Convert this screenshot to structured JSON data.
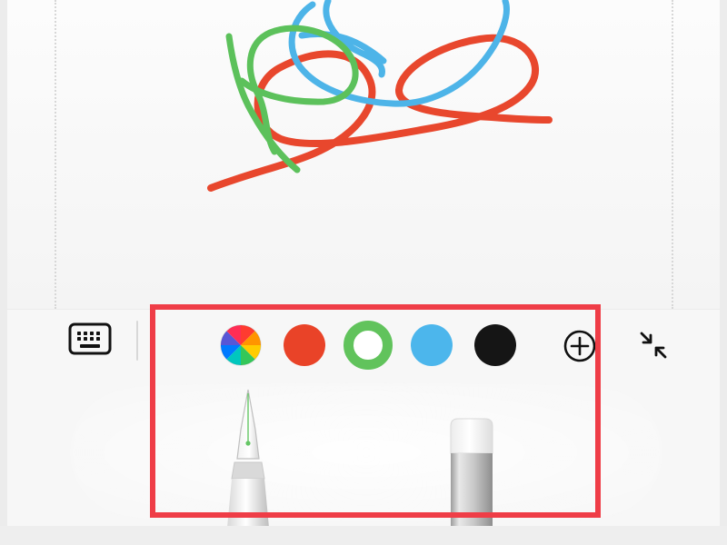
{
  "canvas": {
    "strokes": [
      {
        "color_name": "red",
        "color": "#e8472d"
      },
      {
        "color_name": "blue",
        "color": "#4db4e8"
      },
      {
        "color_name": "green",
        "color": "#5cc15b"
      }
    ]
  },
  "toolbar": {
    "keyboard_icon": "keyboard-icon",
    "divider": "vertical-divider",
    "swatches": [
      {
        "name": "rainbow",
        "color": "multicolor-wheel"
      },
      {
        "name": "red",
        "color": "#e94328"
      },
      {
        "name": "green",
        "color": "#61c35c",
        "selected": true
      },
      {
        "name": "blue",
        "color": "#4cb6ec"
      },
      {
        "name": "black",
        "color": "#151515"
      }
    ],
    "add_icon": "plus-circle-icon",
    "minimize_icon": "collapse-arrows-icon"
  },
  "tools": [
    {
      "name": "pen",
      "icon": "pen-icon"
    },
    {
      "name": "eraser",
      "icon": "eraser-icon"
    }
  ],
  "highlight": {
    "color": "#ef3d47"
  }
}
